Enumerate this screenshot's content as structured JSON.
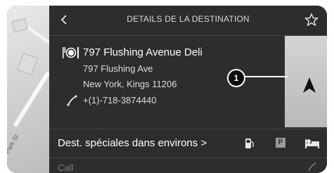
{
  "header": {
    "title": "DETAILS DE LA DESTINATION",
    "back_icon": "chevron-left-icon",
    "favorite_icon": "star-outline-icon"
  },
  "map": {
    "street_label": "Park St"
  },
  "destination": {
    "name": "797 Flushing Avenue Deli",
    "address_line1": "797 Flushing Ave",
    "address_line2": "New York, Kings 11206",
    "phone": "+(1)-718-3874440",
    "category_icon": "restaurant-icon",
    "phone_icon": "phone-icon"
  },
  "navigate": {
    "icon": "navigation-arrow-icon",
    "callout_number": "1"
  },
  "pois": {
    "label": "Dest. spéciales dans environs >",
    "park_letter": "P",
    "icons": [
      "fuel-station-icon",
      "parking-icon",
      "hotel-bed-icon"
    ]
  },
  "call_row": {
    "label": "Call",
    "icon": "phone-icon"
  },
  "colors": {
    "panel": "#2d2d2d",
    "text": "#ffffff",
    "muted": "#dcdcdc",
    "nav_button": "#c7c7c7"
  }
}
